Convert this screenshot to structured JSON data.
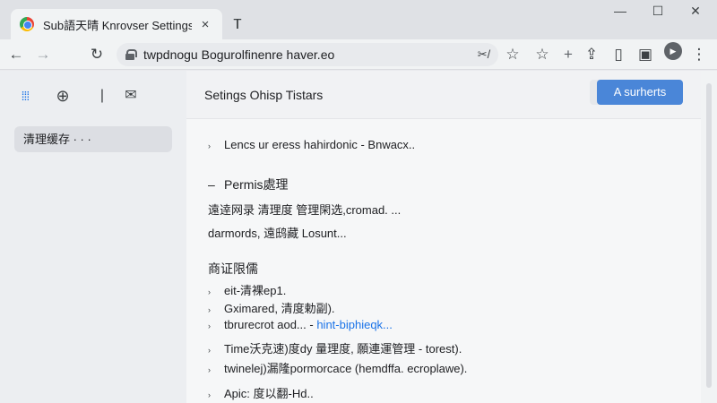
{
  "tab": {
    "title": "Sub語天晴 Knrovser Settings",
    "close": "×"
  },
  "window": {
    "new_tab": "ᴛ",
    "minimize": "—",
    "maximize": "☐",
    "close": "✕"
  },
  "toolbar": {
    "back": "←",
    "forward": "→",
    "reload": "↻",
    "url": "twpdnogu Bogurolfinenre haver.eo",
    "url_right": "✂/",
    "star": "☆",
    "star2": "☆",
    "plus": "+",
    "share": "⇪",
    "tabs": "▯",
    "screenshot": "▣",
    "menu": "⋮",
    "avatar": "▶"
  },
  "sidebar": {
    "icons": {
      "apps": "⁞⁞⁞",
      "globe": "⊕",
      "divider": "|",
      "mail": "✉"
    },
    "item": "清理缓存 · · ·"
  },
  "main": {
    "title": "Setings Ohisp Tistars",
    "primary_button": "A surherts",
    "lines": [
      {
        "chev": "›",
        "text": "Lencs ur eress hahirdonic - Bnwacx..",
        "blue": false
      },
      {
        "chev": "–",
        "text": "Permis處理",
        "heading": true
      },
      {
        "text": "遠逹网录 清理度 管理閑选,cromad. ..."
      },
      {
        "text": "darmords, 遠鸱藏 Losunt..."
      },
      {
        "text": "商证限儒",
        "heading": true
      },
      {
        "chev": "›",
        "text": "eit-清裸ep1."
      },
      {
        "chev": "›",
        "text": "Gximared, 清度勅副)."
      },
      {
        "chev": "›",
        "text": "tbrurecrot aod... - ",
        "blue_tail": "hint-biphieqk..."
      },
      {
        "chev": "›",
        "text": "Time沃克速)度dy 量理度, 願連運管理 - torest)."
      },
      {
        "chev": "›",
        "text": "twinelej)漏隆pormorcace (hemdffa. ecroplawe)."
      },
      {
        "chev": "›",
        "text": "Apic: 度以翻-Hd.."
      }
    ]
  }
}
